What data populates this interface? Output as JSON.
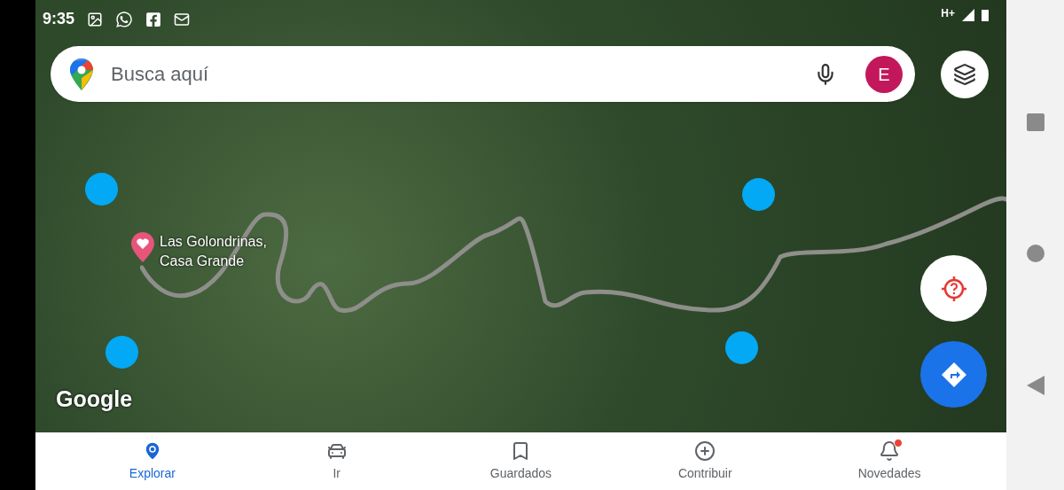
{
  "status_bar": {
    "time": "9:35",
    "network": "H+"
  },
  "search": {
    "placeholder": "Busca aquí",
    "avatar": "E"
  },
  "place": {
    "name": "Las Golondrinas, Casa Grande"
  },
  "map_logo": "Google",
  "nav": [
    {
      "label": "Explorar",
      "selected": true,
      "has_badge": false
    },
    {
      "label": "Ir",
      "selected": false,
      "has_badge": false
    },
    {
      "label": "Guardados",
      "selected": false,
      "has_badge": false
    },
    {
      "label": "Contribuir",
      "selected": false,
      "has_badge": false
    },
    {
      "label": "Novedades",
      "selected": false,
      "has_badge": true
    }
  ]
}
